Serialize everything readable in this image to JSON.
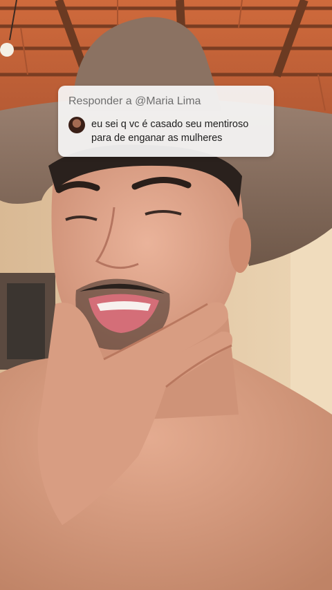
{
  "reply": {
    "header": "Responder a @Maria Lima",
    "comment_lines": [
      "eu sei q vc é casado seu mentiroso",
      "para de enganar as mulheres"
    ]
  },
  "colors": {
    "roof": "#c9643a",
    "hat": "#8e7564",
    "wall": "#e6cfae",
    "skin": "#d59b80",
    "card": "#f6f6f6"
  }
}
